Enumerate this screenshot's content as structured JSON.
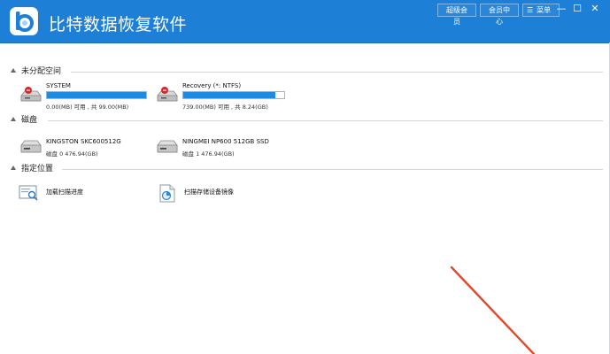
{
  "app": {
    "title": "比特数据恢复软件",
    "header_buttons": [
      "超级会员",
      "会员中心",
      "菜单"
    ]
  },
  "sections": {
    "unallocated": {
      "title": "未分配空间",
      "items": [
        {
          "name": "SYSTEM",
          "info": "0.00(MB) 可用 , 共 99.00(MB)",
          "used_fraction": 1.0
        },
        {
          "name": "Recovery (*: NTFS)",
          "info": "739.00(MB) 可用 , 共 8.24(GB)",
          "used_fraction": 0.91
        }
      ]
    },
    "disks": {
      "title": "磁盘",
      "items": [
        {
          "name": "KINGSTON SKC600512G",
          "info": "磁盘 0     476.94(GB)"
        },
        {
          "name": "NINGMEI NP600 512GB SSD",
          "info": "磁盘 1     476.94(GB)"
        }
      ]
    },
    "locations": {
      "title": "指定位置",
      "items": [
        {
          "label": "加载扫描进度",
          "icon": "load-scan-progress-icon"
        },
        {
          "label": "扫描存储设备镜像",
          "icon": "disk-image-icon"
        }
      ]
    }
  },
  "colors": {
    "titlebar": "#1e7fd6",
    "progress_fill": "#1e8ae0",
    "annotation_arrow": "#e2482b"
  }
}
